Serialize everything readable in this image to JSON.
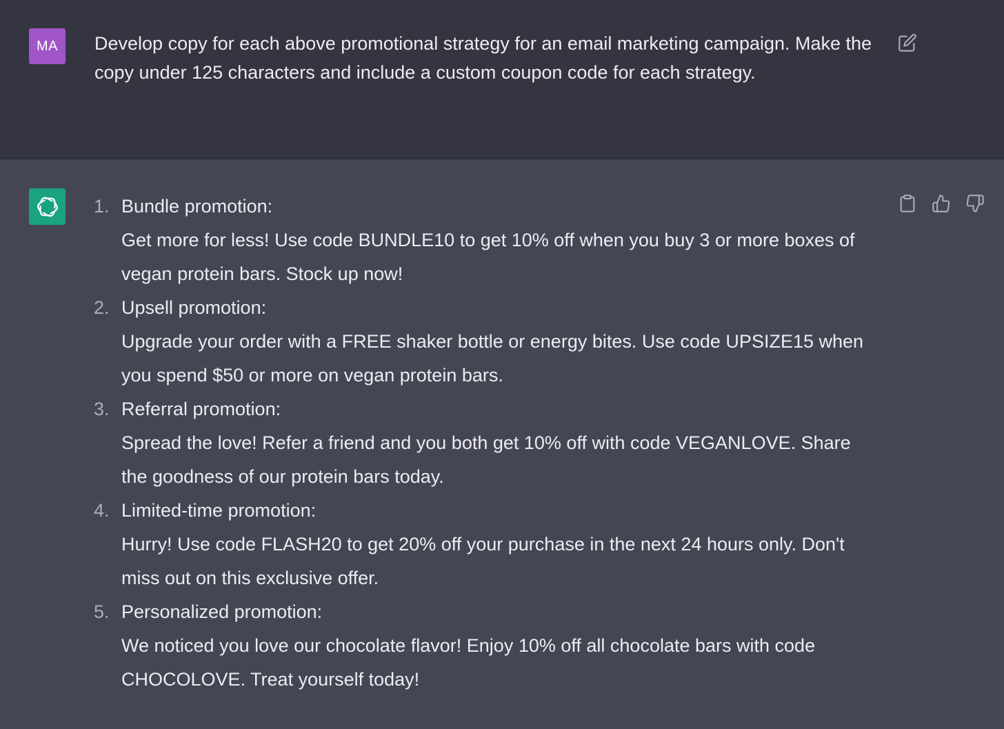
{
  "user": {
    "avatar_initials": "MA",
    "message": "Develop copy for each above promotional strategy for an email marketing campaign. Make the copy under 125 characters and include a custom coupon code for each strategy."
  },
  "assistant": {
    "items": [
      {
        "number": "1.",
        "title": "Bundle promotion:",
        "copy": "Get more for less! Use code BUNDLE10 to get 10% off when you buy 3 or more boxes of vegan protein bars. Stock up now!"
      },
      {
        "number": "2.",
        "title": "Upsell promotion:",
        "copy": "Upgrade your order with a FREE shaker bottle or energy bites. Use code UPSIZE15 when you spend $50 or more on vegan protein bars."
      },
      {
        "number": "3.",
        "title": "Referral promotion:",
        "copy": "Spread the love! Refer a friend and you both get 10% off with code VEGANLOVE. Share the goodness of our protein bars today."
      },
      {
        "number": "4.",
        "title": "Limited-time promotion:",
        "copy": "Hurry! Use code FLASH20 to get 20% off your purchase in the next 24 hours only. Don't miss out on this exclusive offer."
      },
      {
        "number": "5.",
        "title": "Personalized promotion:",
        "copy": "We noticed you love our chocolate flavor! Enjoy 10% off all chocolate bars with code CHOCOLOVE. Treat yourself today!"
      }
    ]
  },
  "icons": {
    "edit": "edit-icon",
    "copy": "clipboard-icon",
    "like": "thumbs-up-icon",
    "dislike": "thumbs-down-icon",
    "assistant_logo": "openai-logo-icon"
  },
  "colors": {
    "user_bg": "#343541",
    "assistant_bg": "#444654",
    "user_avatar": "#a056c7",
    "assistant_avatar": "#19a37f"
  }
}
